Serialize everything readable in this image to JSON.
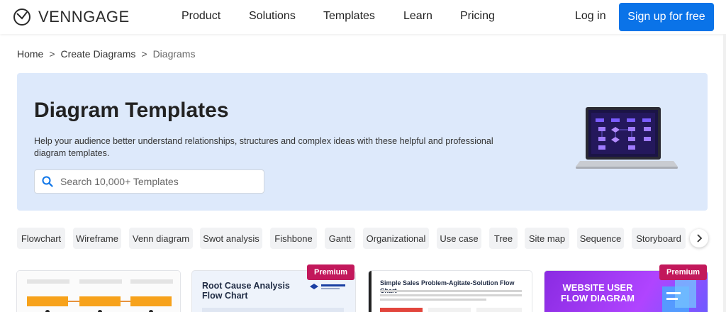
{
  "brand": {
    "name": "VENNGAGE"
  },
  "nav": {
    "items": [
      "Product",
      "Solutions",
      "Templates",
      "Learn",
      "Pricing"
    ],
    "login": "Log in",
    "signup": "Sign up for free"
  },
  "breadcrumb": {
    "home": "Home",
    "parent": "Create Diagrams",
    "current": "Diagrams",
    "separator": ">"
  },
  "hero": {
    "title": "Diagram Templates",
    "description": "Help your audience better understand relationships, structures and complex ideas with these helpful and professional diagram templates.",
    "search_placeholder": "Search 10,000+ Templates"
  },
  "categories": [
    "Flowchart",
    "Wireframe",
    "Venn diagram",
    "Swot analysis",
    "Fishbone",
    "Gantt",
    "Organizational",
    "Use case",
    "Tree",
    "Site map",
    "Sequence",
    "Storyboard"
  ],
  "cards": [
    {
      "title": "",
      "premium": false
    },
    {
      "title": "Root Cause Analysis Flow Chart",
      "premium": true,
      "badge": "Premium"
    },
    {
      "title": "Simple Sales Problem-Agitate-Solution Flow Chart",
      "premium": false
    },
    {
      "title": "WEBSITE USER FLOW DIAGRAM",
      "premium": true,
      "badge": "Premium"
    }
  ],
  "colors": {
    "accent": "#0a73e8",
    "hero_bg": "#dde9fb",
    "premium": "#c2185b"
  },
  "icons": {
    "search": "search-icon",
    "next": "chevron-right-icon",
    "logo": "venngage-logo-icon"
  }
}
